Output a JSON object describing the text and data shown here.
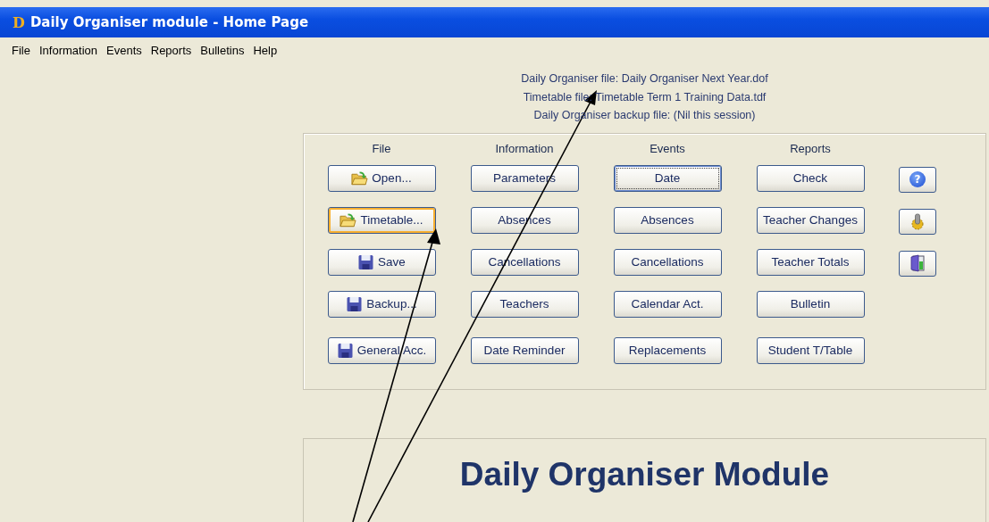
{
  "window": {
    "logo": "D",
    "title": "Daily Organiser module - Home Page"
  },
  "menu": [
    "File",
    "Information",
    "Events",
    "Reports",
    "Bulletins",
    "Help"
  ],
  "info_lines": [
    "Daily Organiser file: Daily Organiser Next Year.dof",
    "Timetable file: Timetable Term 1 Training Data.tdf",
    "Daily Organiser backup file: (Nil this session)"
  ],
  "columns": [
    {
      "header": "File",
      "buttons": [
        {
          "label": "Open...",
          "highlighted": false,
          "focused": false
        },
        {
          "label": "Timetable...",
          "highlighted": true,
          "focused": false
        },
        {
          "label": "Save",
          "highlighted": false,
          "focused": false
        },
        {
          "label": "Backup...",
          "highlighted": false,
          "focused": false
        },
        {
          "label": "General Acc.",
          "highlighted": false,
          "focused": false
        }
      ]
    },
    {
      "header": "Information",
      "buttons": [
        {
          "label": "Parameters",
          "highlighted": false,
          "focused": false
        },
        {
          "label": "Absences",
          "highlighted": false,
          "focused": false
        },
        {
          "label": "Cancellations",
          "highlighted": false,
          "focused": false
        },
        {
          "label": "Teachers",
          "highlighted": false,
          "focused": false
        },
        {
          "label": "Date Reminder",
          "highlighted": false,
          "focused": false
        }
      ]
    },
    {
      "header": "Events",
      "buttons": [
        {
          "label": "Date",
          "highlighted": false,
          "focused": true
        },
        {
          "label": "Absences",
          "highlighted": false,
          "focused": false
        },
        {
          "label": "Cancellations",
          "highlighted": false,
          "focused": false
        },
        {
          "label": "Calendar Act.",
          "highlighted": false,
          "focused": false
        },
        {
          "label": "Replacements",
          "highlighted": false,
          "focused": false
        }
      ]
    },
    {
      "header": "Reports",
      "buttons": [
        {
          "label": "Check",
          "highlighted": false,
          "focused": false
        },
        {
          "label": "Teacher Changes",
          "highlighted": false,
          "focused": false
        },
        {
          "label": "Teacher Totals",
          "highlighted": false,
          "focused": false
        },
        {
          "label": "Bulletin",
          "highlighted": false,
          "focused": false
        },
        {
          "label": "Student T/Table",
          "highlighted": false,
          "focused": false
        }
      ]
    }
  ],
  "tool_buttons": [
    {
      "kind": "help",
      "glyph": "?"
    },
    {
      "kind": "settings"
    },
    {
      "kind": "exit"
    }
  ],
  "banner": {
    "title": "Daily Organiser Module"
  }
}
